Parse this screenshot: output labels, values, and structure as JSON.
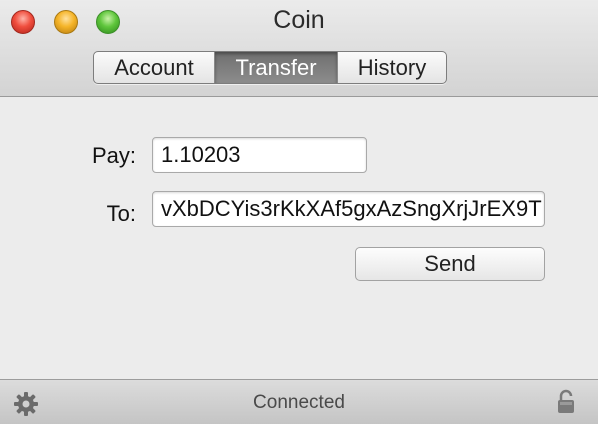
{
  "window": {
    "title": "Coin"
  },
  "tabs": [
    {
      "label": "Account",
      "selected": false
    },
    {
      "label": "Transfer",
      "selected": true
    },
    {
      "label": "History",
      "selected": false
    }
  ],
  "form": {
    "pay_label": "Pay:",
    "pay_value": "1.10203",
    "to_label": "To:",
    "to_value": "vXbDCYis3rKkXAf5gxAzSngXrjJrEX9T",
    "send_label": "Send"
  },
  "status": {
    "text": "Connected"
  },
  "icons": {
    "settings": "gear-icon",
    "lock": "lock-icon"
  },
  "colors": {
    "selected_tab": "#7a7a7a",
    "close": "#f04e3e",
    "minimize": "#f5b428",
    "zoom": "#5fc63c"
  }
}
